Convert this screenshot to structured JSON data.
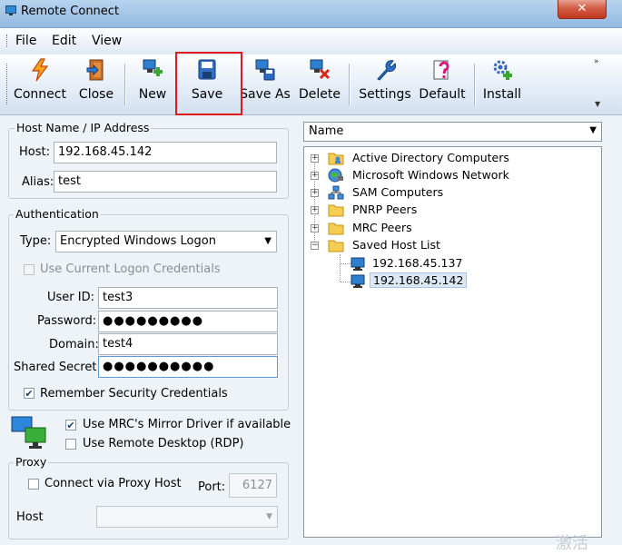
{
  "window": {
    "title": "Remote Connect",
    "close_symbol": "✕"
  },
  "menu": {
    "items": [
      "File",
      "Edit",
      "View"
    ]
  },
  "toolbar": {
    "buttons": [
      {
        "label": "Connect",
        "icon": "lightning-icon"
      },
      {
        "label": "Close",
        "icon": "door-exit-icon"
      },
      {
        "label": "New",
        "icon": "computer-add-icon"
      },
      {
        "label": "Save",
        "icon": "floppy-disk-icon"
      },
      {
        "label": "Save As",
        "icon": "computer-save-as-icon"
      },
      {
        "label": "Delete",
        "icon": "computer-delete-icon"
      },
      {
        "label": "Settings",
        "icon": "wrench-icon"
      },
      {
        "label": "Default",
        "icon": "question-document-icon"
      },
      {
        "label": "Install",
        "icon": "gear-add-icon"
      }
    ],
    "highlighted": "Save"
  },
  "host_group": {
    "title": "Host Name / IP Address",
    "host_label": "Host:",
    "host_value": "192.168.45.142",
    "alias_label": "Alias:",
    "alias_value": "test"
  },
  "auth_group": {
    "title": "Authentication",
    "type_label": "Type:",
    "type_value": "Encrypted Windows Logon",
    "use_current_label": "Use Current Logon Credentials",
    "use_current_checked": false,
    "userid_label": "User ID:",
    "userid_value": "test3",
    "password_label": "Password:",
    "password_mask": "●●●●●●●●●",
    "domain_label": "Domain:",
    "domain_value": "test4",
    "secret_label": "Shared Secret:",
    "secret_mask": "●●●●●●●●●●",
    "remember_label": "Remember Security Credentials",
    "remember_checked": true
  },
  "display_options": {
    "mirror_label": "Use MRC's Mirror Driver if available",
    "mirror_checked": true,
    "rdp_label": "Use Remote Desktop (RDP)",
    "rdp_checked": false
  },
  "proxy_group": {
    "title": "Proxy",
    "connect_label": "Connect via Proxy Host",
    "connect_checked": false,
    "port_label": "Port:",
    "port_value": "6127",
    "host_label": "Host",
    "host_value": ""
  },
  "tree": {
    "column_header": "Name",
    "nodes": [
      {
        "label": "Active Directory Computers",
        "icon": "folder-users-icon",
        "expander": "+"
      },
      {
        "label": "Microsoft Windows Network",
        "icon": "globe-network-icon",
        "expander": "+"
      },
      {
        "label": "SAM Computers",
        "icon": "network-icon",
        "expander": "+"
      },
      {
        "label": "PNRP Peers",
        "icon": "folder-icon",
        "expander": "+"
      },
      {
        "label": "MRC Peers",
        "icon": "folder-icon",
        "expander": "+"
      },
      {
        "label": "Saved Host List",
        "icon": "folder-icon",
        "expander": "−"
      }
    ],
    "saved_hosts": [
      "192.168.45.137",
      "192.168.45.142"
    ],
    "selected_host": "192.168.45.142"
  },
  "watermark": "激活"
}
